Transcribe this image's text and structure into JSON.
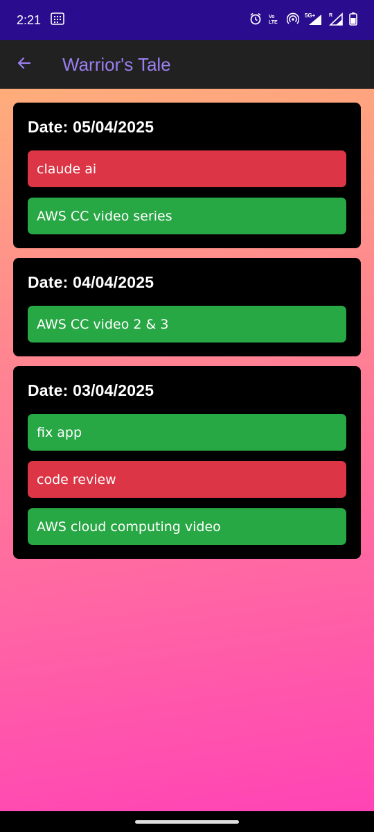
{
  "status_bar": {
    "time": "2:21",
    "icons": [
      "calendar-grid-icon",
      "alarm-icon",
      "volte-icon",
      "hotspot-icon",
      "signal-5g-icon",
      "signal-r-icon",
      "battery-icon"
    ]
  },
  "app_bar": {
    "back_icon": "arrow-left-icon",
    "title": "Warrior's Tale"
  },
  "cards": [
    {
      "date": "Date: 05/04/2025",
      "tasks": [
        {
          "label": "claude ai",
          "status": "red"
        },
        {
          "label": "AWS CC video series",
          "status": "green"
        }
      ]
    },
    {
      "date": "Date: 04/04/2025",
      "tasks": [
        {
          "label": "AWS CC video 2 & 3",
          "status": "green"
        }
      ]
    },
    {
      "date": "Date: 03/04/2025",
      "tasks": [
        {
          "label": "fix app",
          "status": "green"
        },
        {
          "label": "code review",
          "status": "red"
        },
        {
          "label": "AWS cloud computing video",
          "status": "green"
        }
      ]
    }
  ],
  "colors": {
    "status_bar": "#2a0d8f",
    "app_bar": "#212121",
    "title": "#9b7ff0",
    "green": "#28a745",
    "red": "#dc3545"
  }
}
